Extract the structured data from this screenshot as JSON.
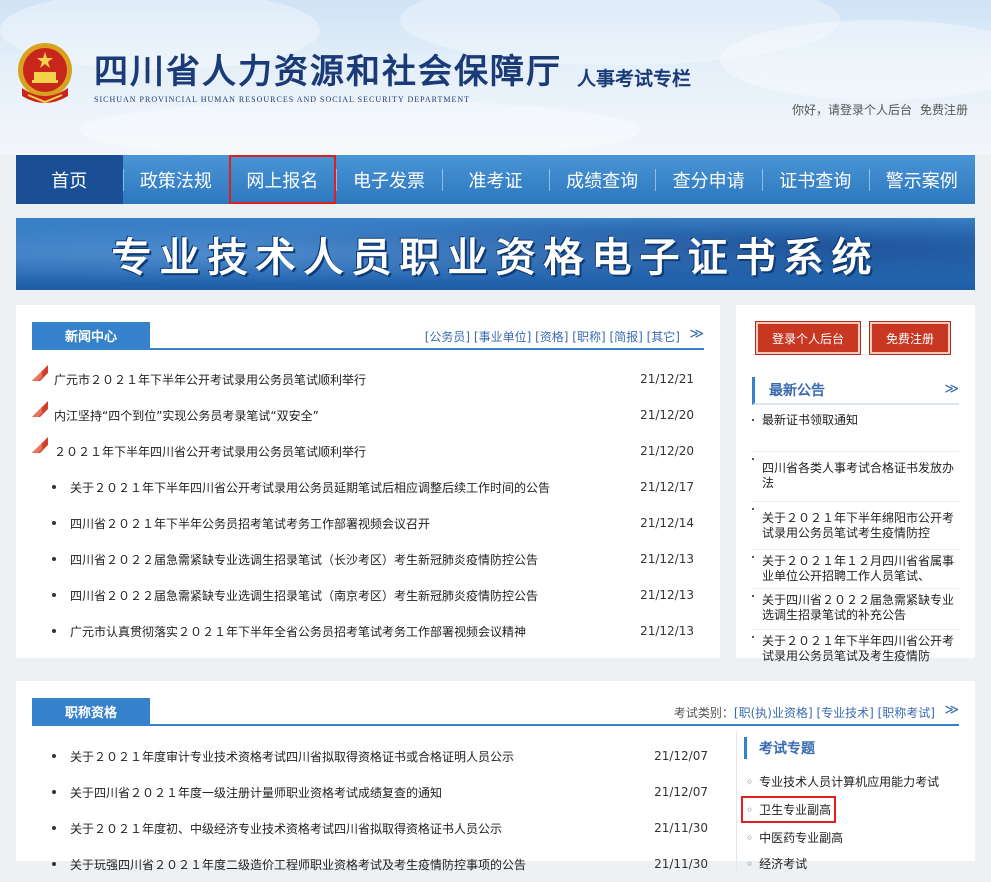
{
  "header": {
    "title": "四川省人力资源和社会保障厅",
    "subtitle": "SICHUAN PROVINCIAL HUMAN RESOURCES AND SOCIAL SECURITY DEPARTMENT",
    "special_column": "人事考试专栏",
    "greeting": "你好，请登录个人后台",
    "register_link": "免费注册"
  },
  "nav": {
    "items": [
      "首页",
      "政策法规",
      "网上报名",
      "电子发票",
      "准考证",
      "成绩查询",
      "查分申请",
      "证书查询",
      "警示案例"
    ]
  },
  "banner": {
    "text": "专业技术人员职业资格电子证书系统"
  },
  "news": {
    "tab_title": "新闻中心",
    "categories": "[公务员] [事业单位] [资格] [职称] [简报] [其它]",
    "more": "≫",
    "items": [
      {
        "title": "广元市２０２１年下半年公开考试录用公务员笔试顺利举行",
        "date": "21/12/21",
        "new": true
      },
      {
        "title": "内江坚持“四个到位”实现公务员考录笔试“双安全”",
        "date": "21/12/20",
        "new": true
      },
      {
        "title": "２０２１年下半年四川省公开考试录用公务员笔试顺利举行",
        "date": "21/12/20",
        "new": true
      },
      {
        "title": "关于２０２１年下半年四川省公开考试录用公务员延期笔试后相应调整后续工作时间的公告",
        "date": "21/12/17",
        "new": false
      },
      {
        "title": "四川省２０２１年下半年公务员招考笔试考务工作部署视频会议召开",
        "date": "21/12/14",
        "new": false
      },
      {
        "title": "四川省２０２２届急需紧缺专业选调生招录笔试（长沙考区）考生新冠肺炎疫情防控公告",
        "date": "21/12/13",
        "new": false
      },
      {
        "title": "四川省２０２２届急需紧缺专业选调生招录笔试（南京考区）考生新冠肺炎疫情防控公告",
        "date": "21/12/13",
        "new": false
      },
      {
        "title": "广元市认真贯彻落实２０２１年下半年全省公务员招考笔试考务工作部署视频会议精神",
        "date": "21/12/13",
        "new": false
      }
    ]
  },
  "side": {
    "login_button": "登录个人后台",
    "register_button": "免费注册",
    "notice_title": "最新公告",
    "more": "≫",
    "notices": [
      "最新证书领取通知",
      "四川省各类人事考试合格证书发放办法",
      "关于２０２１年下半年绵阳市公开考试录用公务员笔试考生疫情防控",
      "关于２０２１年１２月四川省省属事业单位公开招聘工作人员笔试、",
      "关于四川省２０２２届急需紧缺专业选调生招录笔试的补充公告",
      "关于２０２１年下半年四川省公开考试录用公务员笔试及考生疫情防"
    ]
  },
  "cert": {
    "tab_title": "职称资格",
    "category_prefix": "考试类别：",
    "categories": "[职(执)业资格] [专业技术] [职称考试]",
    "more": "≫",
    "items": [
      {
        "title": "关于２０２１年度审计专业技术资格考试四川省拟取得资格证书或合格证明人员公示",
        "date": "21/12/07"
      },
      {
        "title": "关于四川省２０２１年度一级注册计量师职业资格考试成绩复查的通知",
        "date": "21/12/07"
      },
      {
        "title": "关于２０２１年度初、中级经济专业技术资格考试四川省拟取得资格证书人员公示",
        "date": "21/11/30"
      },
      {
        "title": "关于玩强四川省２０２１年度二级造价工程师职业资格考试及考生疫情防控事项的公告",
        "date": "21/11/30"
      }
    ],
    "topic_title": "考试专题",
    "topics": [
      "专业技术人员计算机应用能力考试",
      "卫生专业副高",
      "中医药专业副高",
      "经济考试"
    ]
  }
}
